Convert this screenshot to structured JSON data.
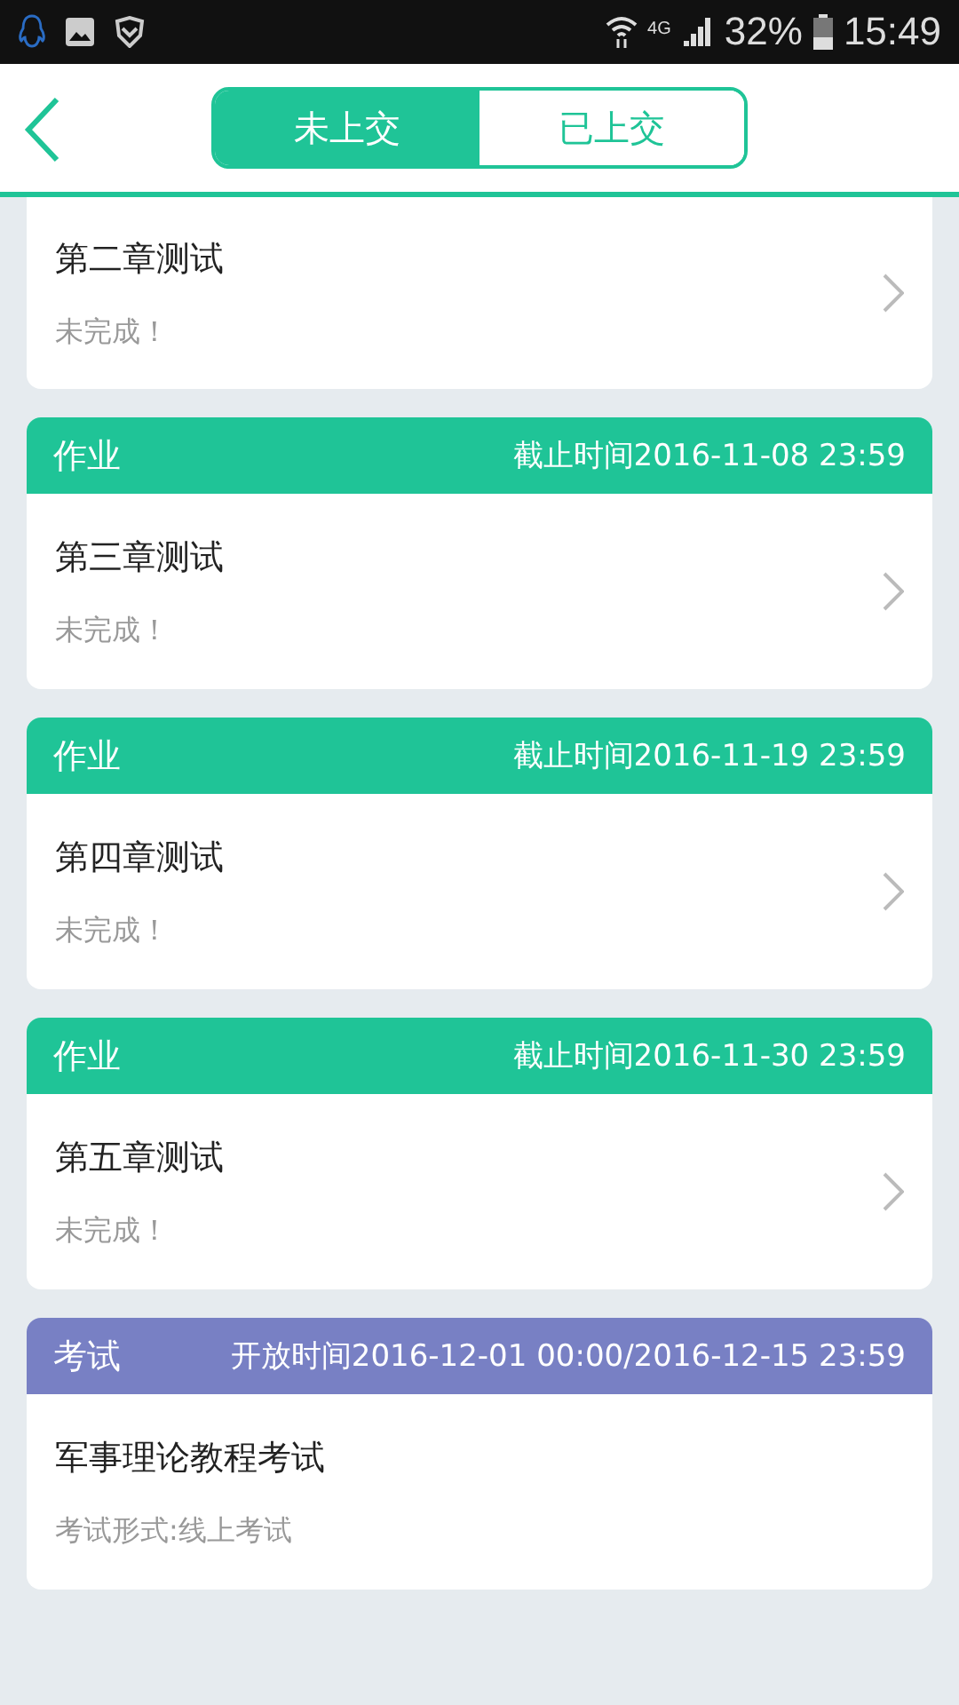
{
  "status_bar": {
    "network": "4G",
    "battery": "32%",
    "time": "15:49"
  },
  "tabs": [
    {
      "label": "未上交",
      "selected": true
    },
    {
      "label": "已上交",
      "selected": false
    }
  ],
  "items": [
    {
      "kind": "homework",
      "title": "第二章测试",
      "subtitle": "未完成！"
    },
    {
      "kind": "homework",
      "type_label": "作业",
      "deadline": "截止时间2016-11-08 23:59",
      "title": "第三章测试",
      "subtitle": "未完成！"
    },
    {
      "kind": "homework",
      "type_label": "作业",
      "deadline": "截止时间2016-11-19 23:59",
      "title": "第四章测试",
      "subtitle": "未完成！"
    },
    {
      "kind": "homework",
      "type_label": "作业",
      "deadline": "截止时间2016-11-30 23:59",
      "title": "第五章测试",
      "subtitle": "未完成！"
    },
    {
      "kind": "exam",
      "type_label": "考试",
      "deadline": "开放时间2016-12-01 00:00/2016-12-15 23:59",
      "title": "军事理论教程考试",
      "subtitle": "考试形式:线上考试"
    }
  ]
}
